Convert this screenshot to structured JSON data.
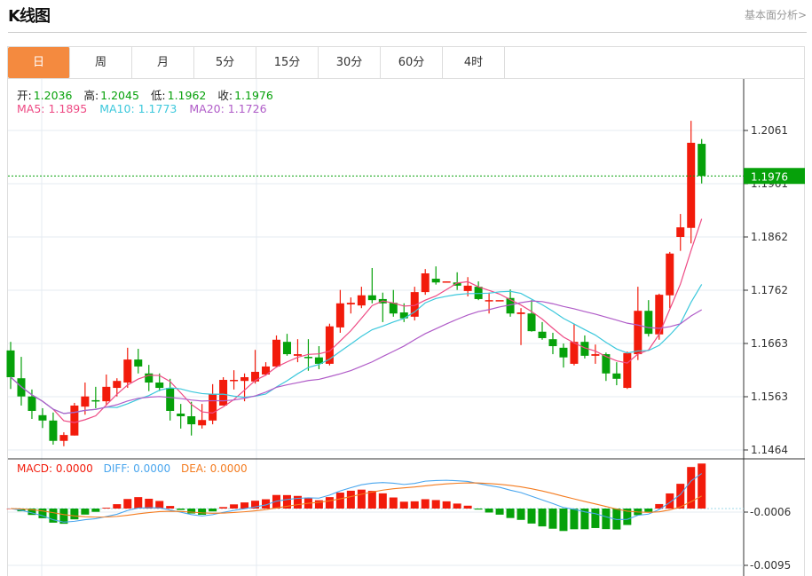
{
  "header": {
    "title": "K线图",
    "link": "基本面分析>"
  },
  "tabs": [
    {
      "label": "日",
      "active": true
    },
    {
      "label": "周"
    },
    {
      "label": "月"
    },
    {
      "label": "5分"
    },
    {
      "label": "15分"
    },
    {
      "label": "30分"
    },
    {
      "label": "60分"
    },
    {
      "label": "4时"
    }
  ],
  "ohlc": {
    "open_label": "开:",
    "open": "1.2036",
    "high_label": "高:",
    "high": "1.2045",
    "low_label": "低:",
    "low": "1.1962",
    "close_label": "收:",
    "close": "1.1976"
  },
  "ma": {
    "ma5_label": "MA5: 1.1895",
    "ma10_label": "MA10: 1.1773",
    "ma20_label": "MA20: 1.1726"
  },
  "macd_info": {
    "macd_label": "MACD: 0.0000",
    "diff_label": "DIFF: 0.0000",
    "dea_label": "DEA: 0.0000"
  },
  "colors": {
    "up": "#f21b0b",
    "down": "#06a10a",
    "ma5": "#ee4a84",
    "ma10": "#3cc8dc",
    "ma20": "#b05cc8",
    "diff": "#4aa6ee",
    "dea": "#f47c20",
    "tab_active": "#f48a3f"
  },
  "chart_data": {
    "type": "candlestick",
    "last_price_label": "1.1976",
    "price_ticks": [
      "1.2061",
      "1.1961",
      "1.1862",
      "1.1762",
      "1.1663",
      "1.1563",
      "1.1464"
    ],
    "price_range": [
      1.1464,
      1.2061
    ],
    "macd_ticks": [
      "-0.0006",
      "-0.0095"
    ],
    "candles_ohlc": [
      [
        1.165,
        1.1666,
        1.1578,
        1.16
      ],
      [
        1.1598,
        1.1638,
        1.1547,
        1.1564
      ],
      [
        1.1564,
        1.1577,
        1.1522,
        1.1537
      ],
      [
        1.1529,
        1.1542,
        1.1505,
        1.1519
      ],
      [
        1.1519,
        1.1534,
        1.1474,
        1.1481
      ],
      [
        1.1481,
        1.1497,
        1.1471,
        1.1492
      ],
      [
        1.1491,
        1.1552,
        1.1491,
        1.1547
      ],
      [
        1.1545,
        1.159,
        1.153,
        1.1564
      ],
      [
        1.1557,
        1.1582,
        1.1542,
        1.1555
      ],
      [
        1.1555,
        1.1605,
        1.1547,
        1.1582
      ],
      [
        1.158,
        1.1598,
        1.1564,
        1.1593
      ],
      [
        1.159,
        1.1655,
        1.158,
        1.1633
      ],
      [
        1.1633,
        1.1653,
        1.1607,
        1.162
      ],
      [
        1.1607,
        1.1623,
        1.1574,
        1.159
      ],
      [
        1.159,
        1.1607,
        1.1574,
        1.158
      ],
      [
        1.158,
        1.1597,
        1.1519,
        1.1537
      ],
      [
        1.1532,
        1.155,
        1.1504,
        1.1527
      ],
      [
        1.1527,
        1.1554,
        1.1491,
        1.1512
      ],
      [
        1.151,
        1.155,
        1.1504,
        1.152
      ],
      [
        1.1519,
        1.1587,
        1.1512,
        1.1569
      ],
      [
        1.1547,
        1.16,
        1.1547,
        1.1595
      ],
      [
        1.1593,
        1.1613,
        1.1577,
        1.1595
      ],
      [
        1.1593,
        1.1607,
        1.1555,
        1.16
      ],
      [
        1.1592,
        1.1651,
        1.1588,
        1.161
      ],
      [
        1.1605,
        1.1628,
        1.1603,
        1.162
      ],
      [
        1.162,
        1.1678,
        1.1618,
        1.167
      ],
      [
        1.1666,
        1.1681,
        1.164,
        1.1643
      ],
      [
        1.164,
        1.1671,
        1.1628,
        1.1643
      ],
      [
        1.1638,
        1.1671,
        1.1612,
        1.1637
      ],
      [
        1.1637,
        1.1658,
        1.1615,
        1.1625
      ],
      [
        1.1625,
        1.17,
        1.1622,
        1.1695
      ],
      [
        1.1693,
        1.1763,
        1.1683,
        1.1738
      ],
      [
        1.1736,
        1.1749,
        1.1719,
        1.1739
      ],
      [
        1.1734,
        1.1769,
        1.1729,
        1.1753
      ],
      [
        1.1753,
        1.1804,
        1.1738,
        1.1744
      ],
      [
        1.1746,
        1.1758,
        1.1703,
        1.1738
      ],
      [
        1.1739,
        1.1763,
        1.1713,
        1.1719
      ],
      [
        1.1721,
        1.1738,
        1.1703,
        1.171
      ],
      [
        1.1713,
        1.1769,
        1.1706,
        1.1759
      ],
      [
        1.1759,
        1.1802,
        1.1754,
        1.1794
      ],
      [
        1.1784,
        1.1807,
        1.1773,
        1.1777
      ],
      [
        1.1777,
        1.1779,
        1.1777,
        1.1779
      ],
      [
        1.1777,
        1.1796,
        1.1763,
        1.1771
      ],
      [
        1.1761,
        1.1787,
        1.1751,
        1.1771
      ],
      [
        1.1769,
        1.1779,
        1.1744,
        1.1746
      ],
      [
        1.1743,
        1.1758,
        1.1719,
        1.1744
      ],
      [
        1.1744,
        1.1744,
        1.1744,
        1.1744
      ],
      [
        1.1748,
        1.1764,
        1.1713,
        1.1719
      ],
      [
        1.1718,
        1.1729,
        1.166,
        1.1721
      ],
      [
        1.1719,
        1.1744,
        1.1685,
        1.1686
      ],
      [
        1.1685,
        1.1703,
        1.167,
        1.1673
      ],
      [
        1.1671,
        1.1683,
        1.1643,
        1.1658
      ],
      [
        1.1655,
        1.1663,
        1.1618,
        1.1637
      ],
      [
        1.1625,
        1.17,
        1.1622,
        1.1666
      ],
      [
        1.1666,
        1.1678,
        1.1635,
        1.164
      ],
      [
        1.164,
        1.1661,
        1.1625,
        1.1643
      ],
      [
        1.1643,
        1.1646,
        1.1593,
        1.1607
      ],
      [
        1.1607,
        1.1628,
        1.1585,
        1.1597
      ],
      [
        1.158,
        1.1648,
        1.1578,
        1.1645
      ],
      [
        1.1643,
        1.1769,
        1.1632,
        1.1724
      ],
      [
        1.1724,
        1.1744,
        1.1676,
        1.1681
      ],
      [
        1.168,
        1.1756,
        1.167,
        1.1754
      ],
      [
        1.1753,
        1.1834,
        1.1729,
        1.1831
      ],
      [
        1.1862,
        1.1905,
        1.1836,
        1.188
      ],
      [
        1.1879,
        1.2079,
        1.185,
        1.2038
      ],
      [
        1.2036,
        1.2045,
        1.1962,
        1.1976
      ]
    ],
    "moving_averages": [
      5,
      10,
      20
    ]
  }
}
